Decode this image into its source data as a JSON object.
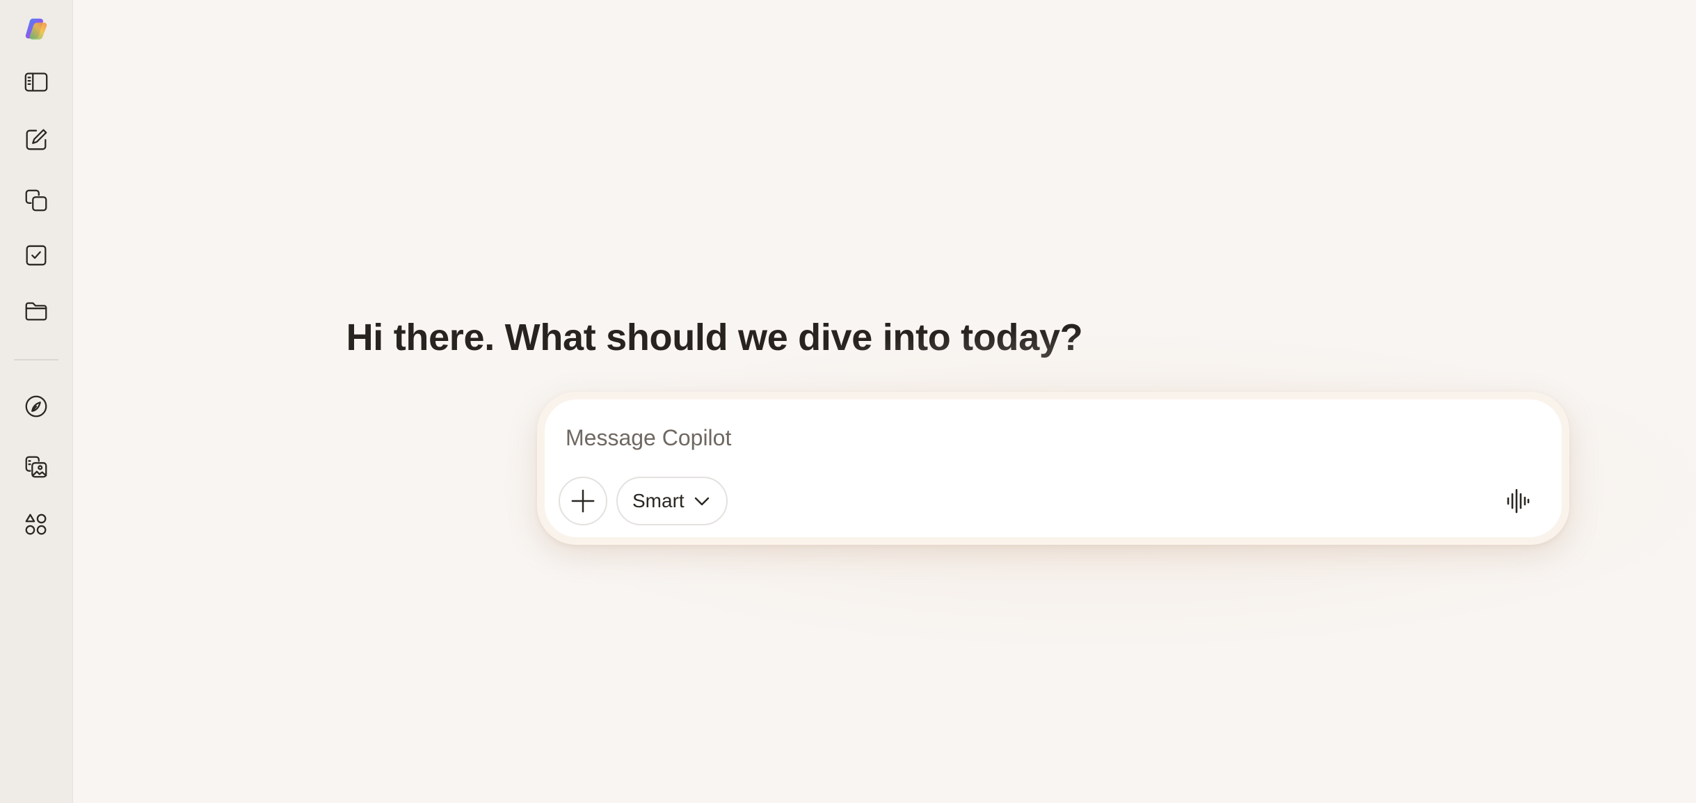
{
  "app": {
    "name": "Copilot",
    "brand_colors": [
      "#f2bf3c",
      "#e8467c",
      "#3b8cf0",
      "#59c26b"
    ],
    "background": "#f8f5f2",
    "sidebar_background": "#efebe7"
  },
  "sidebar": {
    "items": [
      {
        "icon": "copilot-logo-icon",
        "label": "Copilot"
      },
      {
        "icon": "sidebar-toggle-icon",
        "label": "Toggle sidebar"
      },
      {
        "icon": "new-chat-icon",
        "label": "New chat"
      },
      {
        "icon": "pages-icon",
        "label": "Pages"
      },
      {
        "icon": "tasks-icon",
        "label": "Tasks"
      },
      {
        "icon": "folder-icon",
        "label": "Folders"
      },
      {
        "icon": "discover-icon",
        "label": "Discover"
      },
      {
        "icon": "imagine-icon",
        "label": "Imagine"
      },
      {
        "icon": "apps-icon",
        "label": "Apps"
      }
    ]
  },
  "main": {
    "greeting": "Hi there. What should we dive into today?"
  },
  "composer": {
    "placeholder": "Message Copilot",
    "value": "",
    "mode": "Smart",
    "attach_icon": "plus-icon",
    "mode_icon": "chevron-down-icon",
    "voice_icon": "voice-waveform-icon"
  }
}
